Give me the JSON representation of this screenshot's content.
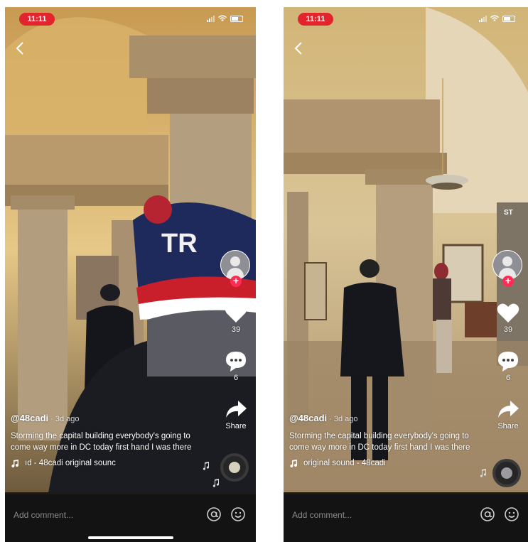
{
  "left": {
    "status_time": "11:11",
    "username": "@48cadi",
    "time_ago": "· 3d ago",
    "description": "Storming the capital building everybody's going to come way more in DC today first hand I was there",
    "music": "ıd - 48cadi    original sounc",
    "likes": "39",
    "comments": "6",
    "share_label": "Share",
    "comment_placeholder": "Add comment...",
    "hat_text": "TR"
  },
  "right": {
    "status_time": "11:11",
    "username": "@48cadi",
    "time_ago": "· 3d ago",
    "description": "Storming the capital building everybody's going to come way more in DC today first hand I was there",
    "music": "original sound - 48cadi",
    "likes": "39",
    "comments": "6",
    "share_label": "Share",
    "comment_placeholder": "Add comment...",
    "sign_text": "ST"
  },
  "colors": {
    "accent": "#fe2c55",
    "status_pill": "#e2252d",
    "comment_bar": "#131313"
  },
  "icons": [
    "back-chevron-icon",
    "signal-icon",
    "wifi-icon",
    "battery-icon",
    "heart-icon",
    "comment-bubble-icon",
    "share-arrow-icon",
    "music-note-icon",
    "at-icon",
    "emoji-icon"
  ]
}
